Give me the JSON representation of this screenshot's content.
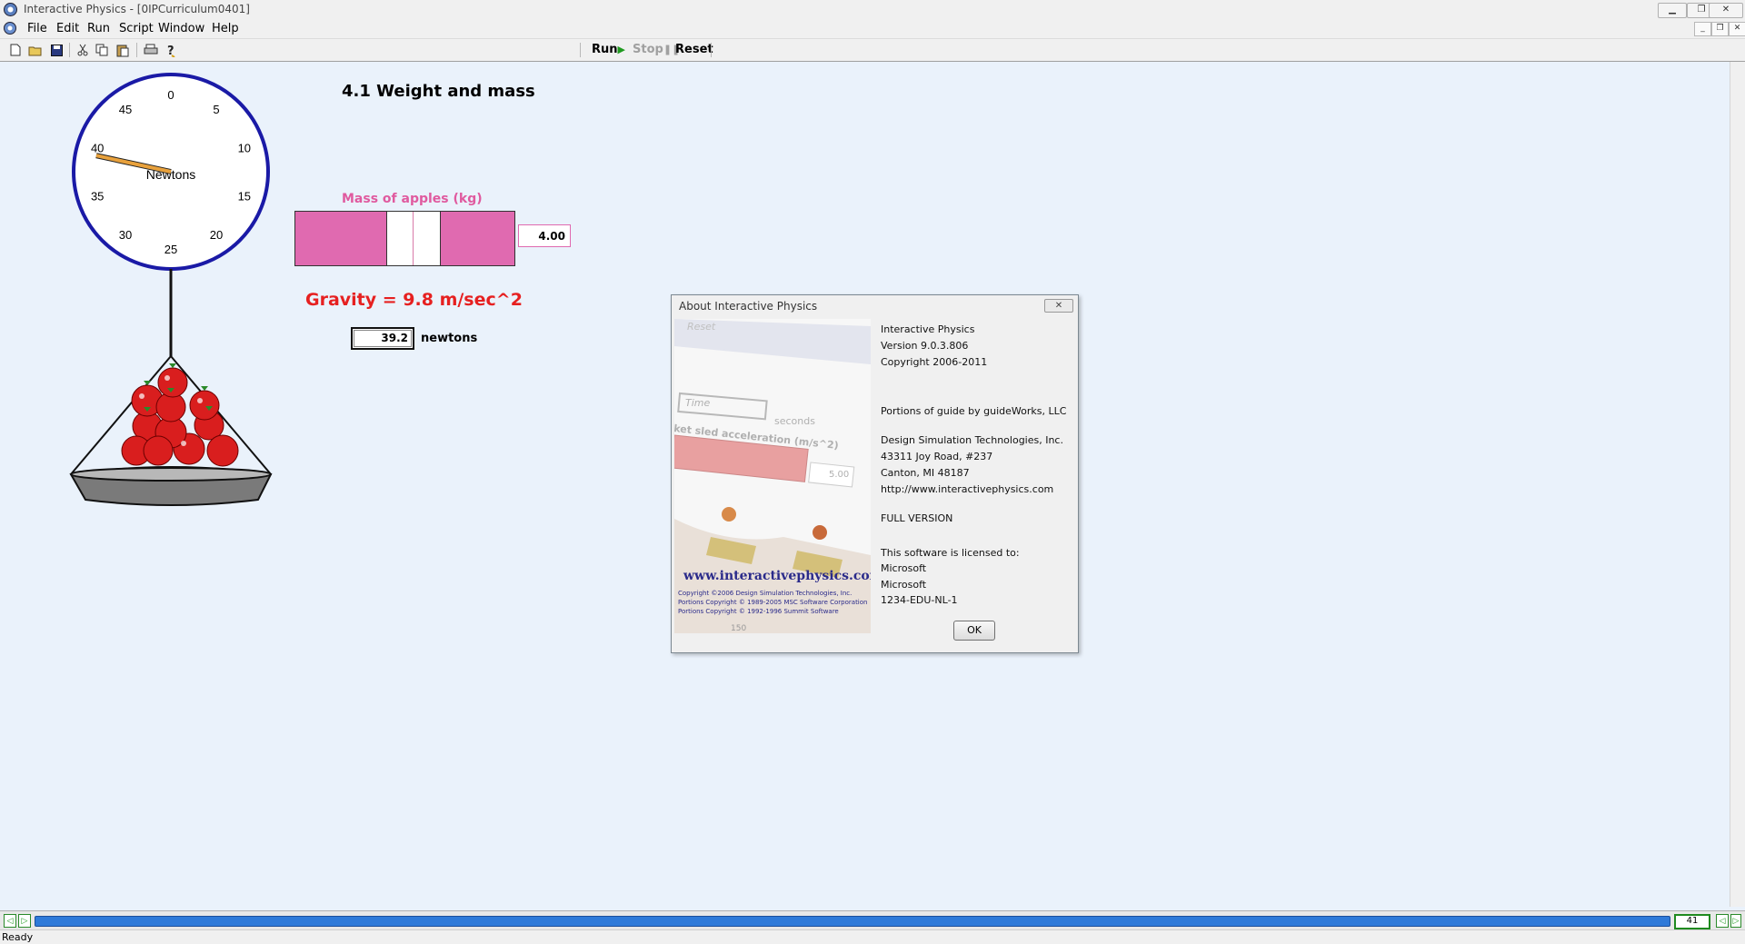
{
  "window": {
    "title": "Interactive Physics - [0IPCurriculum0401]",
    "minimize_glyph": "▁",
    "restore_glyph": "❐",
    "close_glyph": "✕",
    "mdi_minimize_glyph": "_",
    "mdi_restore_glyph": "❐",
    "mdi_close_glyph": "✕"
  },
  "menu": {
    "items": [
      "File",
      "Edit",
      "Run",
      "Script",
      "Window",
      "Help"
    ]
  },
  "toolbar": {
    "icons": [
      "new-file-icon",
      "open-folder-icon",
      "save-icon",
      "cut-icon",
      "copy-icon",
      "paste-icon",
      "print-icon",
      "help-icon"
    ],
    "run_label": "Run",
    "stop_label": "Stop",
    "reset_label": "Reset"
  },
  "canvas": {
    "heading": "4.1 Weight and mass",
    "scale": {
      "ticks": [
        "0",
        "5",
        "10",
        "15",
        "20",
        "25",
        "30",
        "35",
        "40",
        "45"
      ],
      "unit_label": "Newtons",
      "max": 50,
      "value": 39.2
    },
    "slider": {
      "label": "Mass of apples (kg)",
      "value": "4.00",
      "fraction": 0.55
    },
    "gravity_text": "Gravity = 9.8 m/sec^2",
    "weight": {
      "value": "39.2",
      "unit": "newtons"
    }
  },
  "about_dialog": {
    "title": "About Interactive Physics",
    "close_glyph": "✕",
    "product": "Interactive Physics",
    "version": "Version 9.0.3.806",
    "copyright": "Copyright  2006-2011",
    "guide": "Portions of guide by guideWorks, LLC",
    "company": "Design Simulation Technologies, Inc.",
    "address1": "43311 Joy Road, #237",
    "address2": "Canton, MI 48187",
    "url": "http://www.interactivephysics.com",
    "edition": "FULL VERSION",
    "licensed_to_label": "This software is licensed to:",
    "licensee1": "Microsoft",
    "licensee2": "Microsoft",
    "serial": "1234-EDU-NL-1",
    "ok_label": "OK",
    "splash": {
      "reset": "Reset",
      "time": "Time",
      "seconds": "seconds",
      "accel": "ket sled acceleration (m/s^2)",
      "accel_value": "5.00",
      "url": "www.interactivephysics.com",
      "copy1": "Copyright ©2006 Design Simulation Technologies, Inc.",
      "copy2": "Portions Copyright © 1989-2005 MSC Software Corporation",
      "copy3": "Portions Copyright © 1992-1996 Summit Software",
      "bottom": "150"
    }
  },
  "frame_bar": {
    "frame": "41",
    "left_glyph": "◁",
    "right_glyph": "▷"
  },
  "status": {
    "text": "Ready"
  },
  "colors": {
    "canvas_bg": "#eaf2fb",
    "slider_pink": "#e06ab0",
    "gravity_red": "#e62020",
    "dial_blue": "#1a1aa6",
    "needle_orange": "#e8a13c",
    "frame_track": "#2f7ad9"
  }
}
